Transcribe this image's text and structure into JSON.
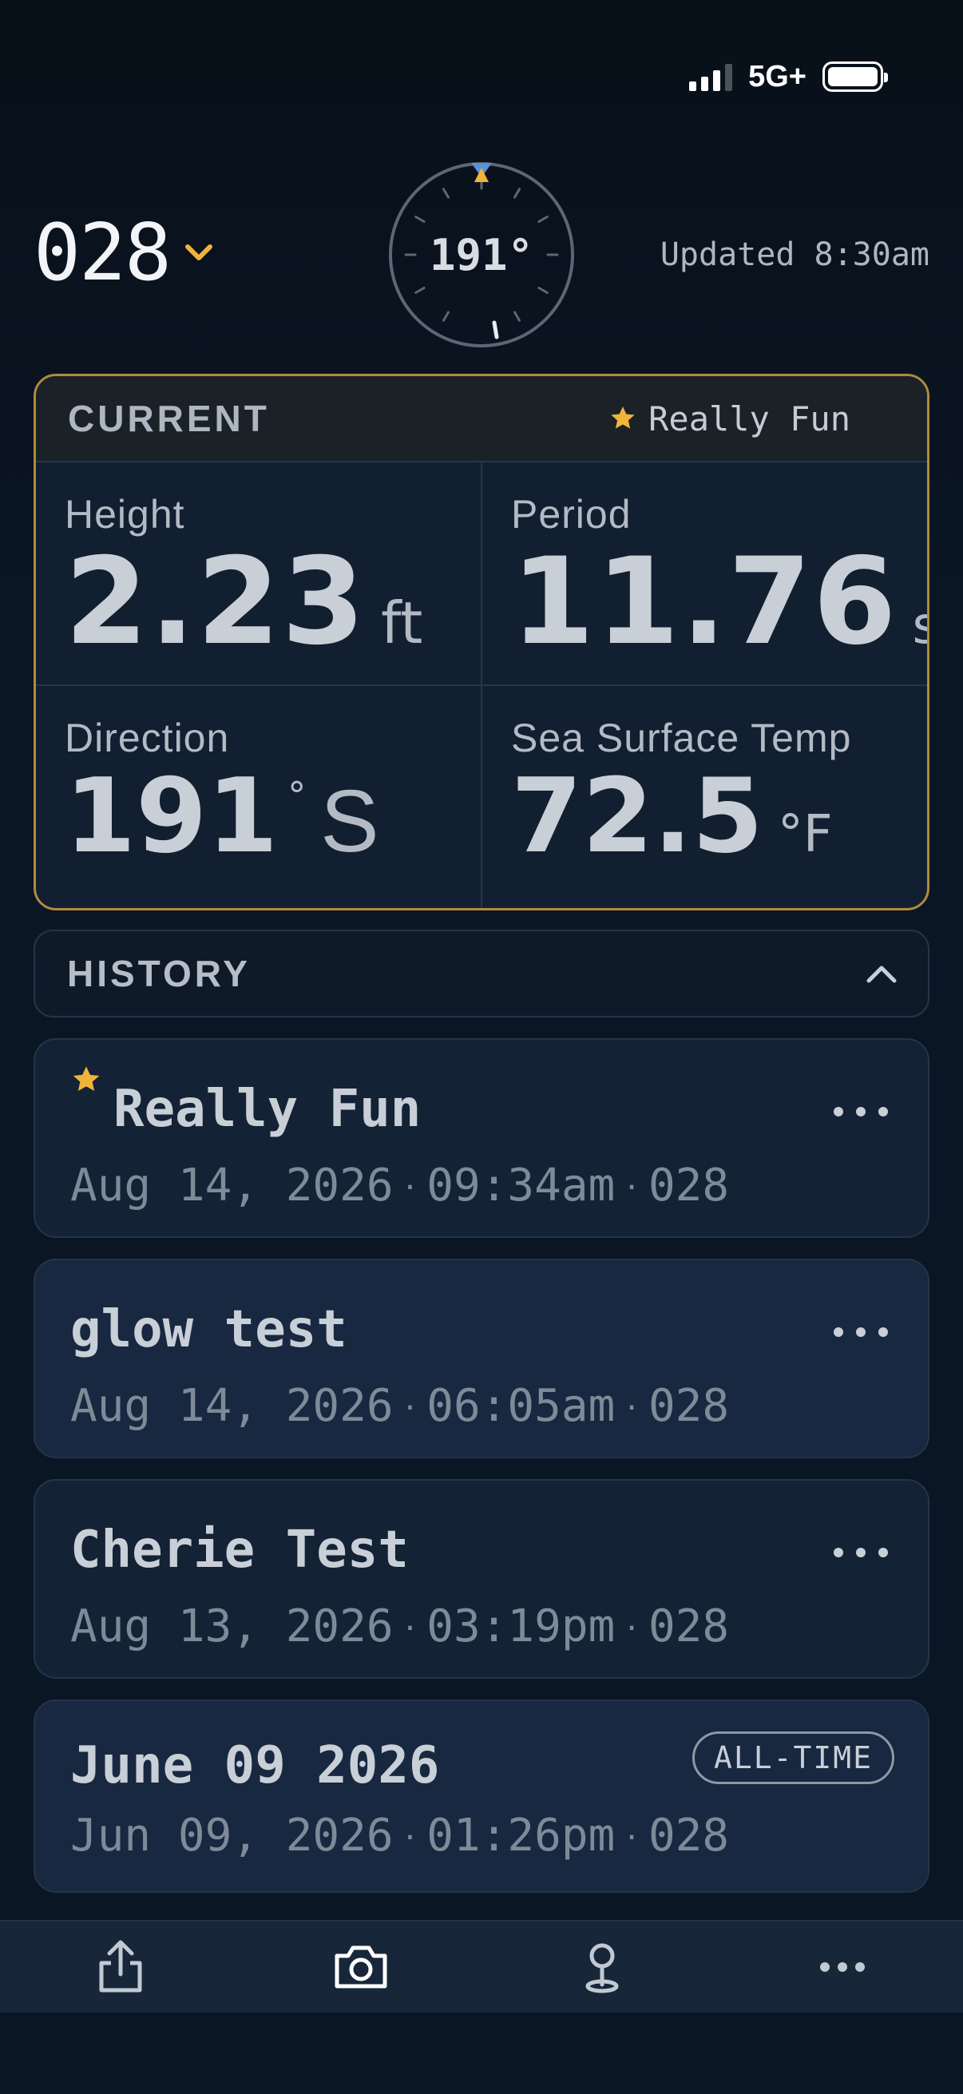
{
  "status_bar": {
    "network": "5G+"
  },
  "header": {
    "station_id": "028",
    "updated": "Updated 8:30am",
    "compass_value": "191°"
  },
  "current": {
    "title": "CURRENT",
    "rating": "Really Fun",
    "height": {
      "label": "Height",
      "value": "2.23",
      "unit": "ft"
    },
    "period": {
      "label": "Period",
      "value": "11.76",
      "unit": "s"
    },
    "direction": {
      "label": "Direction",
      "value": "191",
      "degree": "°",
      "cardinal": "S"
    },
    "sst": {
      "label": "Sea Surface Temp",
      "value": "72.5",
      "unit": "°F"
    }
  },
  "history": {
    "title": "HISTORY",
    "items": [
      {
        "title": "Really Fun",
        "date": "Aug 14, 2026",
        "time": "09:34am",
        "station": "028",
        "starred": true
      },
      {
        "title": "glow test",
        "date": "Aug 14, 2026",
        "time": "06:05am",
        "station": "028"
      },
      {
        "title": "Cherie Test",
        "date": "Aug 13, 2026",
        "time": "03:19pm",
        "station": "028"
      },
      {
        "title": "June 09 2026",
        "date": "Jun 09, 2026",
        "time": "01:26pm",
        "station": "028",
        "badge": "ALL-TIME"
      }
    ]
  },
  "separator": "·",
  "tabbar": {
    "icons": [
      "share-icon",
      "camera-icon",
      "location-pin-icon",
      "more-icon"
    ]
  },
  "colors": {
    "accent": "#f0b43a",
    "border_gold": "#b08b3c",
    "background": "#0b1624"
  }
}
